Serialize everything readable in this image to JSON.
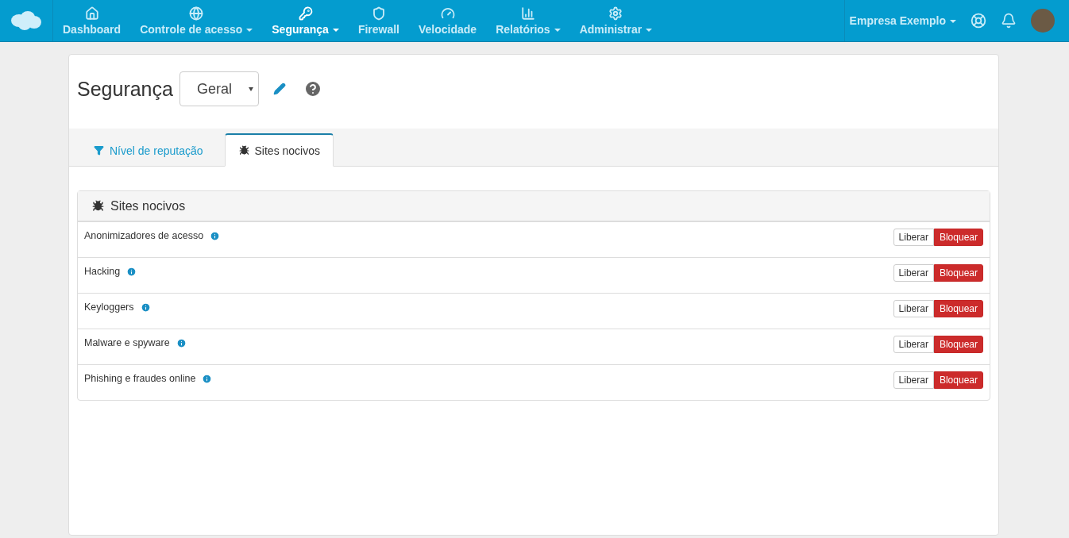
{
  "navbar": {
    "items": [
      {
        "label": "Dashboard",
        "dropdown": false,
        "selected": false
      },
      {
        "label": "Controle de acesso",
        "dropdown": true,
        "selected": false
      },
      {
        "label": "Segurança",
        "dropdown": true,
        "selected": true
      },
      {
        "label": "Firewall",
        "dropdown": false,
        "selected": false
      },
      {
        "label": "Velocidade",
        "dropdown": false,
        "selected": false
      },
      {
        "label": "Relatórios",
        "dropdown": true,
        "selected": false
      },
      {
        "label": "Administrar",
        "dropdown": true,
        "selected": false
      }
    ],
    "company": "Empresa Exemplo"
  },
  "page": {
    "title": "Segurança",
    "profile_select": "Geral"
  },
  "tabs": [
    {
      "label": "Nível de reputação",
      "selected": false
    },
    {
      "label": "Sites nocivos",
      "selected": true
    }
  ],
  "panel": {
    "title": "Sites nocivos",
    "rows": [
      {
        "label": "Anonimizadores de acesso",
        "options": [
          {
            "label": "Liberar",
            "selected": false
          },
          {
            "label": "Bloquear",
            "selected": true
          }
        ]
      },
      {
        "label": "Hacking",
        "options": [
          {
            "label": "Liberar",
            "selected": false
          },
          {
            "label": "Bloquear",
            "selected": true
          }
        ]
      },
      {
        "label": "Keyloggers",
        "options": [
          {
            "label": "Liberar",
            "selected": false
          },
          {
            "label": "Bloquear",
            "selected": true
          }
        ]
      },
      {
        "label": "Malware e spyware",
        "options": [
          {
            "label": "Liberar",
            "selected": false
          },
          {
            "label": "Bloquear",
            "selected": true
          }
        ]
      },
      {
        "label": "Phishing e fraudes online",
        "options": [
          {
            "label": "Liberar",
            "selected": false
          },
          {
            "label": "Bloquear",
            "selected": true
          }
        ]
      }
    ]
  }
}
